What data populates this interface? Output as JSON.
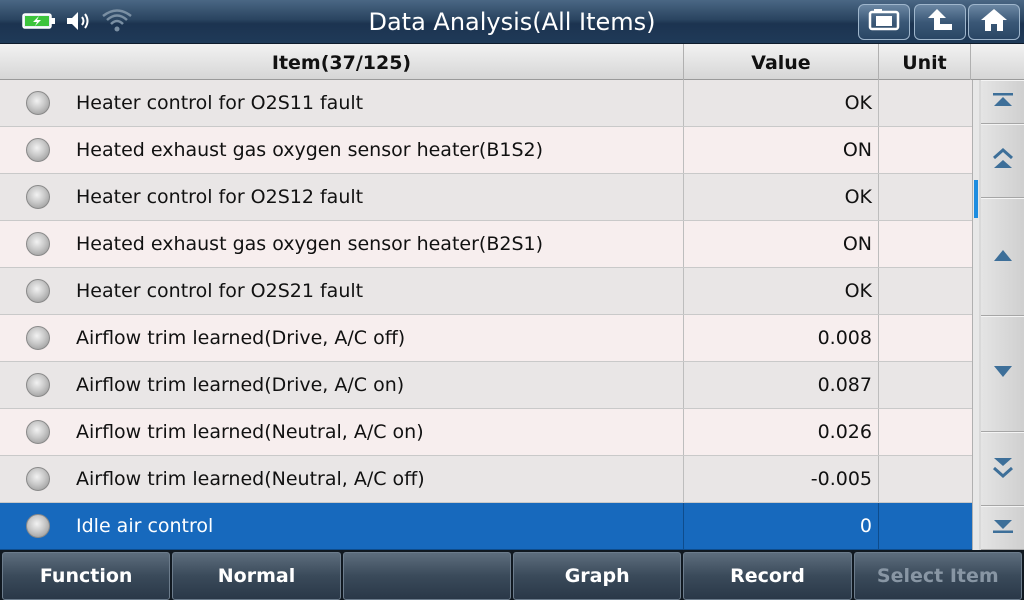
{
  "window": {
    "title": "Data Analysis(All Items)"
  },
  "status": {
    "icons": [
      "battery-charging-icon",
      "volume-icon",
      "wifi-icon"
    ]
  },
  "toolbar": {
    "buttons": [
      "screenshot-icon",
      "back-icon",
      "home-icon"
    ]
  },
  "table": {
    "headers": {
      "item": "Item(37/125)",
      "value": "Value",
      "unit": "Unit"
    },
    "rows": [
      {
        "name": "Heater control for O2S11 fault",
        "value": "OK",
        "unit": ""
      },
      {
        "name": "Heated exhaust gas oxygen sensor heater(B1S2)",
        "value": "ON",
        "unit": ""
      },
      {
        "name": "Heater control for O2S12 fault",
        "value": "OK",
        "unit": ""
      },
      {
        "name": "Heated exhaust gas oxygen sensor heater(B2S1)",
        "value": "ON",
        "unit": ""
      },
      {
        "name": "Heater control for O2S21 fault",
        "value": "OK",
        "unit": ""
      },
      {
        "name": "Airflow trim learned(Drive, A/C off)",
        "value": "0.008",
        "unit": ""
      },
      {
        "name": "Airflow trim learned(Drive, A/C on)",
        "value": "0.087",
        "unit": ""
      },
      {
        "name": "Airflow trim learned(Neutral, A/C on)",
        "value": "0.026",
        "unit": ""
      },
      {
        "name": "Airflow trim learned(Neutral, A/C off)",
        "value": "-0.005",
        "unit": ""
      },
      {
        "name": "Idle air control",
        "value": "0",
        "unit": "",
        "selected": true
      }
    ]
  },
  "bottom_bar": {
    "function": "Function",
    "normal": "Normal",
    "empty": "",
    "graph": "Graph",
    "record": "Record",
    "select_item": "Select Item"
  },
  "colors": {
    "selected_row": "#1769bd",
    "scroll_thumb": "#1e8de0"
  }
}
